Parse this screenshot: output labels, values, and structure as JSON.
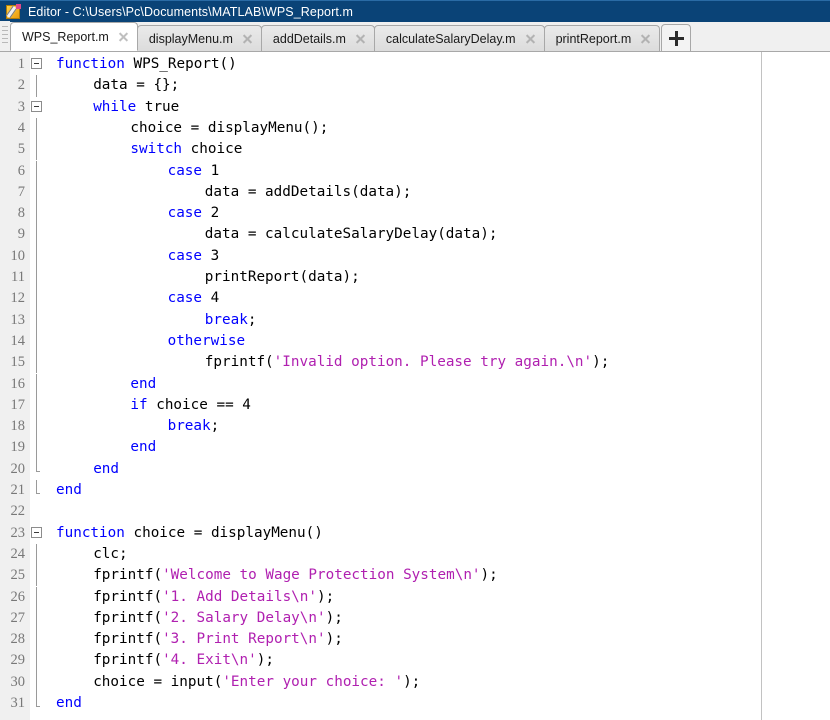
{
  "window": {
    "title": "Editor - C:\\Users\\Pc\\Documents\\MATLAB\\WPS_Report.m",
    "icon": "matlab-editor-icon",
    "titlebar_color": "#0a4377"
  },
  "tabs": {
    "add_label": "+",
    "items": [
      {
        "label": "WPS_Report.m",
        "active": true,
        "closable": true
      },
      {
        "label": "displayMenu.m",
        "active": false,
        "closable": true
      },
      {
        "label": "addDetails.m",
        "active": false,
        "closable": true
      },
      {
        "label": "calculateSalaryDelay.m",
        "active": false,
        "closable": true
      },
      {
        "label": "printReport.m",
        "active": false,
        "closable": true
      }
    ]
  },
  "editor": {
    "first_line": 1,
    "last_visible_line": 31,
    "colors": {
      "keyword": "#0000ff",
      "string": "#b020b0",
      "plain": "#000000",
      "linenumber": "#787878",
      "gutter_bg": "#f0f0f0",
      "background": "#ffffff"
    },
    "lines": [
      {
        "n": 1,
        "fold": "open",
        "tokens": [
          {
            "t": "kw",
            "s": "function"
          },
          {
            "t": "plain",
            "s": " WPS_Report()"
          }
        ],
        "indent": 0
      },
      {
        "n": 2,
        "fold": "bar",
        "tokens": [
          {
            "t": "plain",
            "s": "data = {};"
          }
        ],
        "indent": 4
      },
      {
        "n": 3,
        "fold": "open",
        "tokens": [
          {
            "t": "kw",
            "s": "while"
          },
          {
            "t": "plain",
            "s": " true"
          }
        ],
        "indent": 4
      },
      {
        "n": 4,
        "fold": "bar",
        "tokens": [
          {
            "t": "plain",
            "s": "choice = displayMenu();"
          }
        ],
        "indent": 8
      },
      {
        "n": 5,
        "fold": "bar",
        "tokens": [
          {
            "t": "kw",
            "s": "switch"
          },
          {
            "t": "plain",
            "s": " choice"
          }
        ],
        "indent": 8
      },
      {
        "n": 6,
        "fold": "bar",
        "tokens": [
          {
            "t": "kw",
            "s": "case"
          },
          {
            "t": "plain",
            "s": " 1"
          }
        ],
        "indent": 12
      },
      {
        "n": 7,
        "fold": "bar",
        "tokens": [
          {
            "t": "plain",
            "s": "data = addDetails(data);"
          }
        ],
        "indent": 16
      },
      {
        "n": 8,
        "fold": "bar",
        "tokens": [
          {
            "t": "kw",
            "s": "case"
          },
          {
            "t": "plain",
            "s": " 2"
          }
        ],
        "indent": 12
      },
      {
        "n": 9,
        "fold": "bar",
        "tokens": [
          {
            "t": "plain",
            "s": "data = calculateSalaryDelay(data);"
          }
        ],
        "indent": 16
      },
      {
        "n": 10,
        "fold": "bar",
        "tokens": [
          {
            "t": "kw",
            "s": "case"
          },
          {
            "t": "plain",
            "s": " 3"
          }
        ],
        "indent": 12
      },
      {
        "n": 11,
        "fold": "bar",
        "tokens": [
          {
            "t": "plain",
            "s": "printReport(data);"
          }
        ],
        "indent": 16
      },
      {
        "n": 12,
        "fold": "bar",
        "tokens": [
          {
            "t": "kw",
            "s": "case"
          },
          {
            "t": "plain",
            "s": " 4"
          }
        ],
        "indent": 12
      },
      {
        "n": 13,
        "fold": "bar",
        "tokens": [
          {
            "t": "kw",
            "s": "break"
          },
          {
            "t": "plain",
            "s": ";"
          }
        ],
        "indent": 16
      },
      {
        "n": 14,
        "fold": "bar",
        "tokens": [
          {
            "t": "kw",
            "s": "otherwise"
          }
        ],
        "indent": 12
      },
      {
        "n": 15,
        "fold": "bar",
        "tokens": [
          {
            "t": "plain",
            "s": "fprintf("
          },
          {
            "t": "str",
            "s": "'Invalid option. Please try again.\\n'"
          },
          {
            "t": "plain",
            "s": ");"
          }
        ],
        "indent": 16
      },
      {
        "n": 16,
        "fold": "bar",
        "tokens": [
          {
            "t": "kw",
            "s": "end"
          }
        ],
        "indent": 8
      },
      {
        "n": 17,
        "fold": "bar",
        "tokens": [
          {
            "t": "kw",
            "s": "if"
          },
          {
            "t": "plain",
            "s": " choice == 4"
          }
        ],
        "indent": 8
      },
      {
        "n": 18,
        "fold": "bar",
        "tokens": [
          {
            "t": "kw",
            "s": "break"
          },
          {
            "t": "plain",
            "s": ";"
          }
        ],
        "indent": 12
      },
      {
        "n": 19,
        "fold": "bar",
        "tokens": [
          {
            "t": "kw",
            "s": "end"
          }
        ],
        "indent": 8
      },
      {
        "n": 20,
        "fold": "close",
        "tokens": [
          {
            "t": "kw",
            "s": "end"
          }
        ],
        "indent": 4
      },
      {
        "n": 21,
        "fold": "close",
        "tokens": [
          {
            "t": "kw",
            "s": "end"
          }
        ],
        "indent": 0
      },
      {
        "n": 22,
        "fold": "none",
        "tokens": [],
        "indent": 0
      },
      {
        "n": 23,
        "fold": "open",
        "tokens": [
          {
            "t": "kw",
            "s": "function"
          },
          {
            "t": "plain",
            "s": " choice = displayMenu()"
          }
        ],
        "indent": 0
      },
      {
        "n": 24,
        "fold": "bar",
        "tokens": [
          {
            "t": "plain",
            "s": "clc;"
          }
        ],
        "indent": 4
      },
      {
        "n": 25,
        "fold": "bar",
        "tokens": [
          {
            "t": "plain",
            "s": "fprintf("
          },
          {
            "t": "str",
            "s": "'Welcome to Wage Protection System\\n'"
          },
          {
            "t": "plain",
            "s": ");"
          }
        ],
        "indent": 4
      },
      {
        "n": 26,
        "fold": "bar",
        "tokens": [
          {
            "t": "plain",
            "s": "fprintf("
          },
          {
            "t": "str",
            "s": "'1. Add Details\\n'"
          },
          {
            "t": "plain",
            "s": ");"
          }
        ],
        "indent": 4
      },
      {
        "n": 27,
        "fold": "bar",
        "tokens": [
          {
            "t": "plain",
            "s": "fprintf("
          },
          {
            "t": "str",
            "s": "'2. Salary Delay\\n'"
          },
          {
            "t": "plain",
            "s": ");"
          }
        ],
        "indent": 4
      },
      {
        "n": 28,
        "fold": "bar",
        "tokens": [
          {
            "t": "plain",
            "s": "fprintf("
          },
          {
            "t": "str",
            "s": "'3. Print Report\\n'"
          },
          {
            "t": "plain",
            "s": ");"
          }
        ],
        "indent": 4
      },
      {
        "n": 29,
        "fold": "bar",
        "tokens": [
          {
            "t": "plain",
            "s": "fprintf("
          },
          {
            "t": "str",
            "s": "'4. Exit\\n'"
          },
          {
            "t": "plain",
            "s": ");"
          }
        ],
        "indent": 4
      },
      {
        "n": 30,
        "fold": "bar",
        "tokens": [
          {
            "t": "plain",
            "s": "choice = input("
          },
          {
            "t": "str",
            "s": "'Enter your choice: '"
          },
          {
            "t": "plain",
            "s": ");"
          }
        ],
        "indent": 4
      },
      {
        "n": 31,
        "fold": "close",
        "tokens": [
          {
            "t": "kw",
            "s": "end"
          }
        ],
        "indent": 0
      }
    ]
  }
}
